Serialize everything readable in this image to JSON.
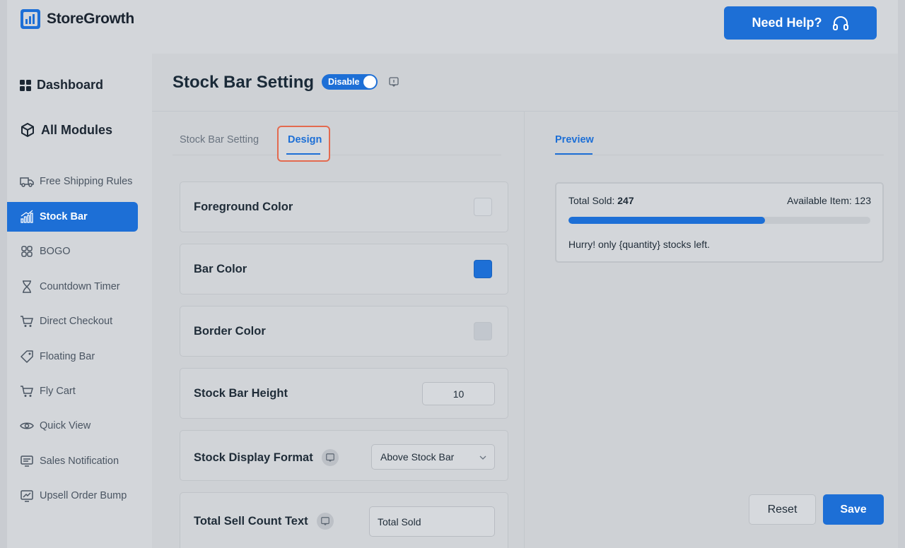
{
  "brand": {
    "name": "StoreGrowth",
    "accent": "#1d6fd6"
  },
  "topbar": {
    "help_label": "Need Help?"
  },
  "sidebar": {
    "dashboard": "Dashboard",
    "all_modules": "All Modules",
    "items": [
      {
        "label": "Free Shipping Rules",
        "icon": "truck-icon"
      },
      {
        "label": "Stock Bar",
        "icon": "bar-chart-icon",
        "active": true
      },
      {
        "label": "BOGO",
        "icon": "grid-icon"
      },
      {
        "label": "Countdown Timer",
        "icon": "hourglass-icon"
      },
      {
        "label": "Direct Checkout",
        "icon": "cart-icon"
      },
      {
        "label": "Floating Bar",
        "icon": "tag-icon"
      },
      {
        "label": "Fly Cart",
        "icon": "cart-icon"
      },
      {
        "label": "Quick View",
        "icon": "eye-icon"
      },
      {
        "label": "Sales Notification",
        "icon": "notification-icon"
      },
      {
        "label": "Upsell Order Bump",
        "icon": "chart-screen-icon"
      }
    ]
  },
  "header": {
    "title": "Stock Bar Setting",
    "toggle_label": "Disable"
  },
  "tabs": {
    "setting": "Stock Bar Setting",
    "design": "Design"
  },
  "settings": {
    "foreground_color": {
      "label": "Foreground Color",
      "color": "#d3d7dc"
    },
    "bar_color": {
      "label": "Bar Color",
      "color": "#1d6fd6"
    },
    "border_color": {
      "label": "Border Color",
      "color": "#c2c7ce"
    },
    "stock_bar_height": {
      "label": "Stock Bar Height",
      "value": "10"
    },
    "stock_display_format": {
      "label": "Stock Display Format",
      "value": "Above Stock Bar"
    },
    "total_sell_count_text": {
      "label": "Total Sell Count Text",
      "value": "Total Sold"
    }
  },
  "preview": {
    "tab_label": "Preview",
    "sold_label": "Total Sold:",
    "sold_value": "247",
    "available_label": "Available Item:",
    "available_value": "123",
    "progress_fraction": 0.65,
    "message": "Hurry! only {quantity} stocks left."
  },
  "actions": {
    "reset": "Reset",
    "save": "Save"
  }
}
